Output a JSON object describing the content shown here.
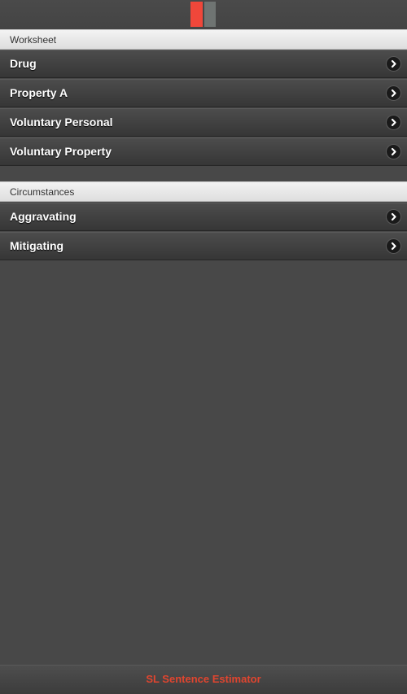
{
  "sections": [
    {
      "header": "Worksheet",
      "items": [
        "Drug",
        "Property A",
        "Voluntary Personal",
        "Voluntary Property"
      ]
    },
    {
      "header": "Circumstances",
      "items": [
        "Aggravating",
        "Mitigating"
      ]
    }
  ],
  "footer": {
    "title": "SL Sentence Estimator"
  },
  "icons": {
    "logo": "app-logo-icon",
    "list_arrow": "chevron-right-icon"
  },
  "colors": {
    "accent": "#f0473a",
    "logo_gray": "#6f7472",
    "background": "#484848"
  }
}
